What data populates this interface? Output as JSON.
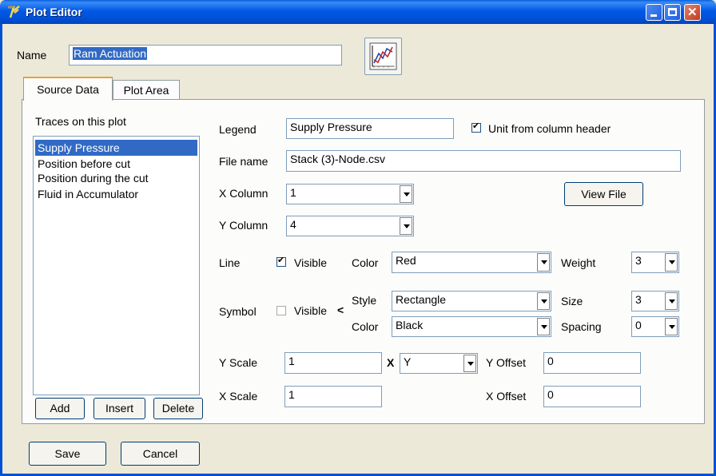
{
  "window": {
    "title": "Plot Editor"
  },
  "name_row": {
    "label": "Name",
    "value": "Ram Actuation",
    "icon": "chart-icon"
  },
  "tabs": [
    {
      "label": "Source Data",
      "active": true
    },
    {
      "label": "Plot Area",
      "active": false
    }
  ],
  "traces": {
    "header": "Traces on this plot",
    "items": [
      "Supply Pressure",
      "Position before cut",
      "Position during the cut",
      "Fluid in Accumulator"
    ],
    "selected": "Supply Pressure",
    "add_label": "Add",
    "insert_label": "Insert",
    "delete_label": "Delete"
  },
  "form": {
    "legend_label": "Legend",
    "legend_value": "Supply Pressure",
    "unit_from_header_label": "Unit from column header",
    "unit_from_header_checked": true,
    "file_name_label": "File name",
    "file_name_value": "Stack (3)-Node.csv",
    "x_column_label": "X Column",
    "x_column_value": "1",
    "view_file_label": "View File",
    "y_column_label": "Y Column",
    "y_column_value": "4",
    "line_label": "Line",
    "line_visible_label": "Visible",
    "line_visible_checked": true,
    "line_color_label": "Color",
    "line_color_value": "Red",
    "weight_label": "Weight",
    "weight_value": "3",
    "symbol_label": "Symbol",
    "symbol_visible_label": "Visible",
    "symbol_visible_checked": false,
    "symbol_arrow": "<",
    "style_label": "Style",
    "style_value": "Rectangle",
    "size_label": "Size",
    "size_value": "3",
    "symbol_color_label": "Color",
    "symbol_color_value": "Black",
    "spacing_label": "Spacing",
    "spacing_value": "0",
    "y_scale_label": "Y Scale",
    "y_scale_value": "1",
    "times_label": "X",
    "multiplier_value": "Y",
    "y_offset_label": "Y Offset",
    "y_offset_value": "0",
    "x_scale_label": "X Scale",
    "x_scale_value": "1",
    "x_offset_label": "X Offset",
    "x_offset_value": "0"
  },
  "footer": {
    "save_label": "Save",
    "cancel_label": "Cancel"
  },
  "colors": {
    "title_bar": "#0058e6",
    "window_bg": "#ece9d8",
    "selection": "#316ac5"
  }
}
